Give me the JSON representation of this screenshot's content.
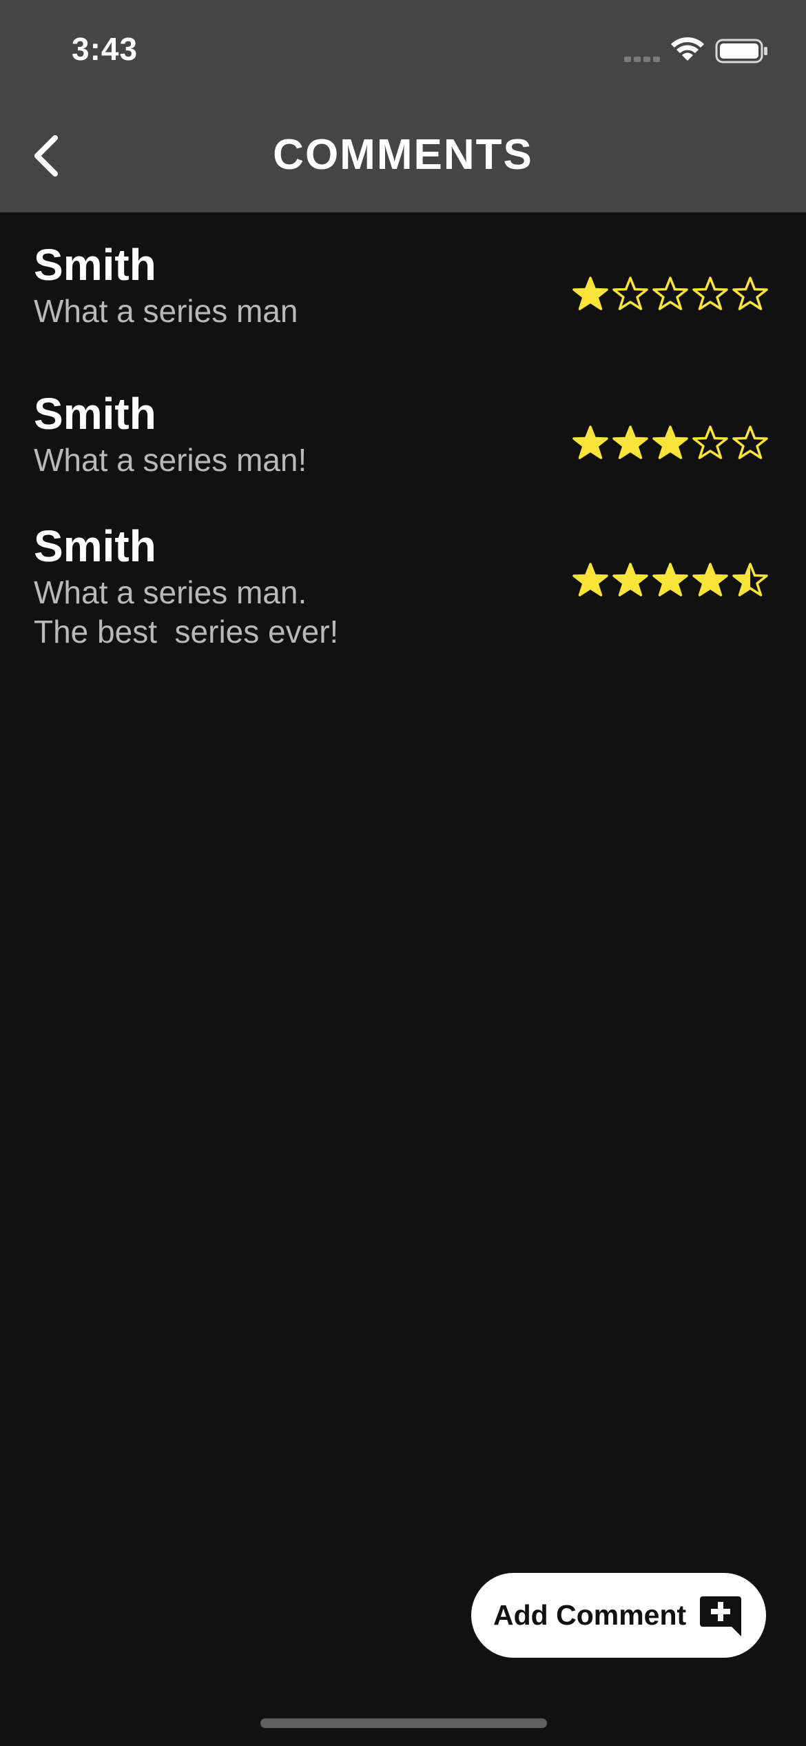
{
  "status_bar": {
    "time": "3:43"
  },
  "nav": {
    "title": "COMMENTS",
    "back_icon": "chevron-left-icon"
  },
  "comments": [
    {
      "author": "Smith",
      "text": "What a series man",
      "rating": 1
    },
    {
      "author": "Smith",
      "text": "What a series man!",
      "rating": 3
    },
    {
      "author": "Smith",
      "text": "What a series man.\nThe best  series ever!",
      "rating": 4.5
    }
  ],
  "add_comment": {
    "label": "Add Comment",
    "icon": "add-comment-icon"
  },
  "colors": {
    "header_bg": "#454545",
    "page_bg": "#111111",
    "star": "#f9e43a",
    "comment_text": "#b9b9b9",
    "button_bg": "#ffffff"
  }
}
